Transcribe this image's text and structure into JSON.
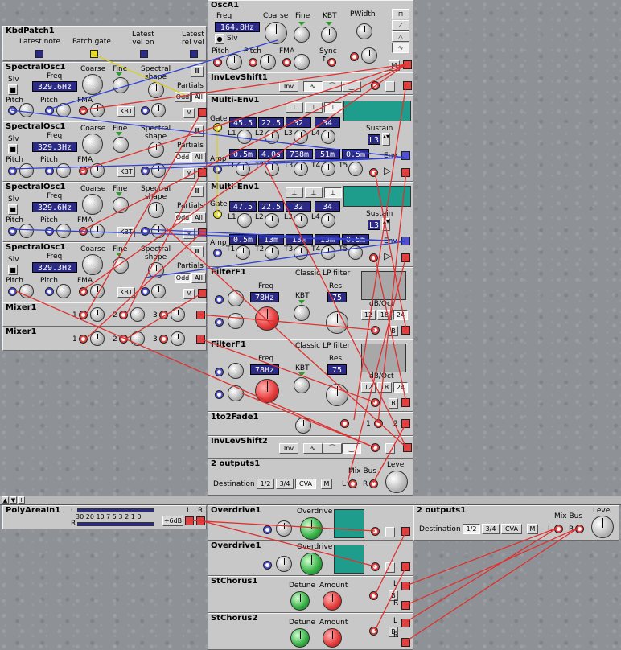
{
  "colors": {
    "panel": "#c8c8c8",
    "display": "#2b2a86",
    "cable_red": "#e03030",
    "cable_blue": "#3040d0",
    "cable_yellow": "#d8d020",
    "graph": "#1e9c8c"
  },
  "kbd": {
    "title": "KbdPatch1",
    "latest_note": "Latest note",
    "patch_gate": "Patch gate",
    "latest_vel_on": "Latest\nvel on",
    "latest_rel_vel": "Latest\nrel vel"
  },
  "spectral": [
    {
      "title": "SpectralOsc1",
      "freq": "329.6Hz"
    },
    {
      "title": "SpectralOsc1",
      "freq": "329.3Hz"
    },
    {
      "title": "SpectralOsc1",
      "freq": "329.6Hz"
    },
    {
      "title": "SpectralOsc1",
      "freq": "329.3Hz"
    }
  ],
  "spectral_labels": {
    "coarse": "Coarse",
    "fine": "Fine",
    "freq": "Freq",
    "slv": "Slv",
    "pitch": "Pitch",
    "fma": "FMA",
    "kbt": "KBT",
    "spectral_shape": "Spectral\nshape",
    "partials": "Partials",
    "odd": "Odd",
    "all": "All",
    "m": "M"
  },
  "mixers": [
    {
      "title": "Mixer1"
    },
    {
      "title": "Mixer1"
    }
  ],
  "mixer_inputs": [
    "1",
    "2",
    "3"
  ],
  "osca": {
    "title": "OscA1",
    "freq_label": "Freq",
    "freq": "164.8Hz",
    "coarse": "Coarse",
    "fine": "Fine",
    "kbt": "KBT",
    "pwidth": "PWidth",
    "slv": "Slv",
    "pitch1": "Pitch",
    "pitch2": "Pitch",
    "fma": "FMA",
    "sync": "Sync",
    "m": "M"
  },
  "invlev": [
    {
      "title": "InvLevShift1",
      "inv": "Inv"
    },
    {
      "title": "InvLevShift2",
      "inv": "Inv"
    }
  ],
  "env": [
    {
      "title": "Multi-Env1",
      "gate": "Gate",
      "levels": [
        "45.5",
        "22.5",
        "32",
        "34"
      ],
      "level_labels": [
        "L1",
        "L2",
        "L3",
        "L4"
      ],
      "sustain": "Sustain",
      "sustain_val": "L3",
      "times": [
        "0.5m",
        "4.0s",
        "738m",
        "51m",
        "0.5m"
      ],
      "time_labels": [
        "T1",
        "T2",
        "T3",
        "T4",
        "T5"
      ],
      "amp": "Amp",
      "env": "Env"
    },
    {
      "title": "Multi-Env1",
      "gate": "Gate",
      "levels": [
        "47.5",
        "22.5",
        "32",
        "34"
      ],
      "level_labels": [
        "L1",
        "L2",
        "L3",
        "L4"
      ],
      "sustain": "Sustain",
      "sustain_val": "L3",
      "times": [
        "0.5m",
        "13m",
        "13m",
        "13m",
        "0.5m"
      ],
      "time_labels": [
        "T1",
        "T2",
        "T3",
        "T4",
        "T5"
      ],
      "amp": "Amp",
      "env": "Env"
    }
  ],
  "filters": [
    {
      "title": "FilterF1",
      "type": "Classic LP filter",
      "freq_label": "Freq",
      "freq": "78Hz",
      "res_label": "Res",
      "res": "75",
      "kbt": "KBT",
      "dboct": "dB/Oct",
      "slopes": [
        "12",
        "18",
        "24"
      ],
      "b": "B"
    },
    {
      "title": "FilterF1",
      "type": "Classic LP filter",
      "freq_label": "Freq",
      "freq": "78Hz",
      "res_label": "Res",
      "res": "75",
      "kbt": "KBT",
      "dboct": "dB/Oct",
      "slopes": [
        "12",
        "18",
        "24"
      ],
      "b": "B"
    }
  ],
  "fade": {
    "title": "1to2Fade1",
    "l1": "1",
    "l2": "2"
  },
  "outputs_top": {
    "title": "2 outputs1",
    "destination": "Destination",
    "opts": [
      "1/2",
      "3/4",
      "CVA"
    ],
    "m": "M",
    "mix_bus": "Mix Bus",
    "l": "L",
    "r": "R",
    "level": "Level"
  },
  "poly": {
    "title": "PolyAreaIn1",
    "scale": "30 20 10  7  5  3  2  1  0",
    "l": "L",
    "r": "R",
    "gain": "+6dB"
  },
  "overdrive": [
    {
      "title": "Overdrive1",
      "label": "Overdrive"
    },
    {
      "title": "Overdrive1",
      "label": "Overdrive"
    }
  ],
  "outputs_bottom": {
    "title": "2 outputs1",
    "destination": "Destination",
    "opts": [
      "1/2",
      "3/4",
      "CVA"
    ],
    "m": "M",
    "mix_bus": "Mix Bus",
    "l": "L",
    "r": "R",
    "level": "Level"
  },
  "chorus": [
    {
      "title": "StChorus1",
      "detune": "Detune",
      "amount": "Amount",
      "l": "L",
      "r": "R",
      "b": "B"
    },
    {
      "title": "StChorus2",
      "detune": "Detune",
      "amount": "Amount",
      "l": "L",
      "r": "R",
      "b": "B"
    }
  ]
}
